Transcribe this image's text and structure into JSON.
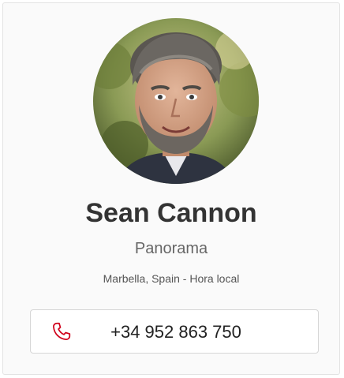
{
  "contact": {
    "name": "Sean Cannon",
    "company": "Panorama",
    "location": "Marbella, Spain - Hora local",
    "phone": "+34 952 863 750"
  },
  "icons": {
    "phone": "phone-icon"
  },
  "colors": {
    "phone_icon": "#d0021b",
    "name_text": "#333333",
    "card_background": "#fafafa"
  }
}
